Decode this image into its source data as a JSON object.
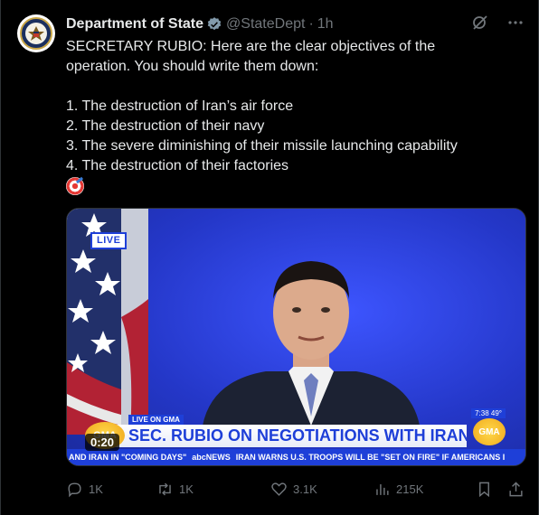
{
  "author": {
    "name": "Department of State",
    "handle": "@StateDept",
    "separator": "·",
    "time": "1h"
  },
  "tweet": {
    "lines": [
      "SECRETARY RUBIO: Here are the clear objectives of the",
      "operation. You should write them down:",
      "1. The destruction of Iran’s air force",
      "2. The destruction of their navy",
      "3. The severe diminishing of their missile launching capability",
      "4. The destruction of their factories"
    ],
    "emoji_icon": "direct-hit-target-icon"
  },
  "video": {
    "live_badge": "LIVE",
    "live_on": "LIVE ON GMA",
    "headline": "SEC. RUBIO ON NEGOTIATIONS WITH IRAN",
    "gma_logo": "GMA",
    "time_temp": "7:38  49°",
    "ticker_left": "AND IRAN IN \"COMING DAYS\"",
    "ticker_brand": "abcNEWS",
    "ticker_right": "IRAN WARNS U.S. TROOPS WILL BE \"SET ON FIRE\" IF AMERICANS I",
    "duration": "0:20"
  },
  "actions": {
    "replies": "1K",
    "retweets": "1K",
    "likes": "3.1K",
    "views": "215K"
  },
  "colors": {
    "background": "#000000",
    "text": "#e7e9ea",
    "muted": "#71767b",
    "verified": "#829aab",
    "gma_blue": "#1e3fd8"
  }
}
